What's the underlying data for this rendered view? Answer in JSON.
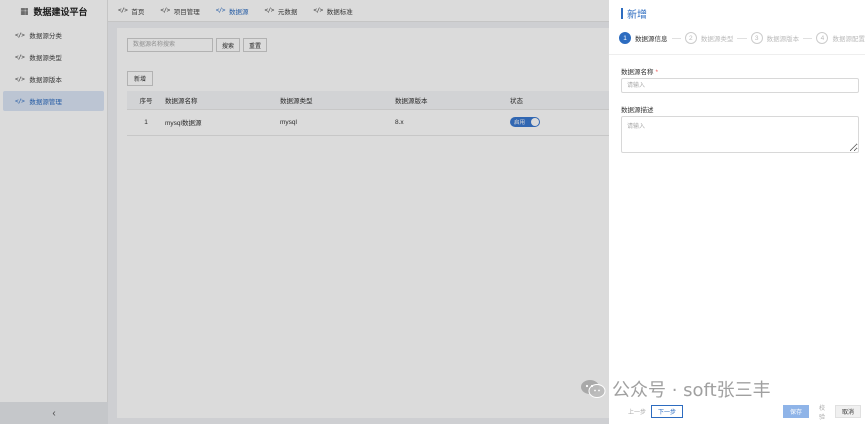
{
  "app": {
    "title": "数据建设平台",
    "logo_icon": "grid-icon"
  },
  "sidebar": {
    "items": [
      {
        "label": "数据源分类",
        "icon": "code-icon",
        "active": false
      },
      {
        "label": "数据源类型",
        "icon": "code-icon",
        "active": false
      },
      {
        "label": "数据源版本",
        "icon": "code-icon",
        "active": false
      },
      {
        "label": "数据源管理",
        "icon": "code-icon",
        "active": true
      }
    ],
    "collapse_glyph": "‹"
  },
  "topnav": {
    "tabs": [
      {
        "label": "首页",
        "active": false
      },
      {
        "label": "项目管理",
        "active": false
      },
      {
        "label": "数据源",
        "active": true
      },
      {
        "label": "元数据",
        "active": false
      },
      {
        "label": "数据标准",
        "active": false
      }
    ]
  },
  "main": {
    "search_placeholder": "数据源名称搜索",
    "search_button": "搜索",
    "reset_button": "重置",
    "add_button": "新增",
    "table": {
      "headers": [
        "序号",
        "数据源名称",
        "数据源类型",
        "数据源版本",
        "状态"
      ],
      "rows": [
        {
          "index": "1",
          "name": "mysql数据源",
          "type": "mysql",
          "version": "8.x",
          "status": "启用",
          "enabled": true
        }
      ]
    }
  },
  "drawer": {
    "title": "新增",
    "steps": [
      {
        "num": "1",
        "label": "数据源信息",
        "active": true
      },
      {
        "num": "2",
        "label": "数据源类型",
        "active": false
      },
      {
        "num": "3",
        "label": "数据源版本",
        "active": false
      },
      {
        "num": "4",
        "label": "数据源配置",
        "active": false
      }
    ],
    "name_label": "数据源名称",
    "name_required_mark": "*",
    "name_placeholder": "请输入",
    "desc_label": "数据源描述",
    "desc_placeholder": "请输入",
    "prev_button": "上一步",
    "next_button": "下一步",
    "save_button": "保存",
    "verify_button": "校验",
    "cancel_button": "取消"
  },
  "watermark": {
    "text": "公众号 · soft张三丰",
    "icon": "wechat-icon"
  },
  "colors": {
    "accent": "#2d6cc0",
    "active_bg": "#dbe6f6",
    "overlay": "rgba(0,0,0,0.14)"
  }
}
